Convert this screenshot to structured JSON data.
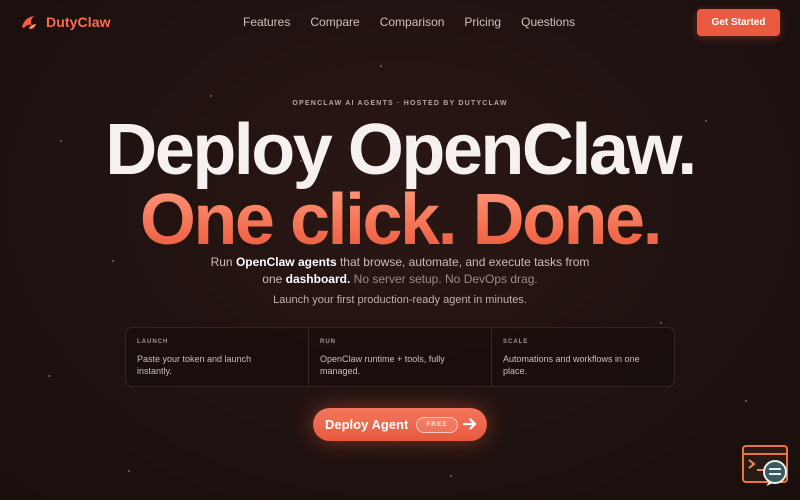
{
  "nav": {
    "brand": "DutyClaw",
    "links": [
      "Features",
      "Compare",
      "Comparison",
      "Pricing",
      "Questions"
    ],
    "cta": "Get Started"
  },
  "hero": {
    "eyebrow": "OPENCLAW AI AGENTS · HOSTED BY DUTYCLAW",
    "title_line1": "Deploy OpenClaw.",
    "title_line2": "One click. Done.",
    "sub_run": "Run ",
    "sub_bold": "OpenClaw agents",
    "sub_mid": " that browse, automate, and execute tasks from one ",
    "sub_bold2": "dashboard.",
    "sub_muted": " No server setup. No DevOps drag.",
    "sub2": "Launch your first production-ready agent in minutes."
  },
  "features": [
    {
      "tag": "LAUNCH",
      "text": "Paste your token and launch instantly."
    },
    {
      "tag": "RUN",
      "text": "OpenClaw runtime + tools, fully managed."
    },
    {
      "tag": "SCALE",
      "text": "Automations and workflows in one place."
    }
  ],
  "deploy": {
    "label": "Deploy Agent",
    "badge": "FREE"
  },
  "colors": {
    "accent": "#e95a3f",
    "background": "#1f1210"
  },
  "icons": {
    "brand": "claw-logo-icon",
    "deploy": "arrow-right-icon",
    "widget": "chat-support-icon"
  }
}
